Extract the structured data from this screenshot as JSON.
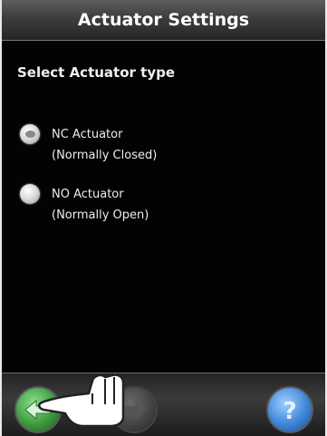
{
  "header": {
    "title": "Actuator Settings"
  },
  "main": {
    "section_label": "Select Actuator type",
    "options": [
      {
        "line1": "NC Actuator",
        "line2": "(Normally Closed)",
        "selected": true
      },
      {
        "line1": "NO Actuator",
        "line2": "(Normally Open)",
        "selected": false
      }
    ]
  },
  "footer": {
    "buttons": [
      {
        "icon": "back-arrow-icon"
      },
      {
        "icon": "next-arrow-icon"
      },
      {
        "icon": "question-mark-icon"
      }
    ]
  },
  "colors": {
    "background": "#030303",
    "title_bar": "#3d3d3d",
    "back_button": "#3e9a3e",
    "help_button": "#3f86d8"
  }
}
